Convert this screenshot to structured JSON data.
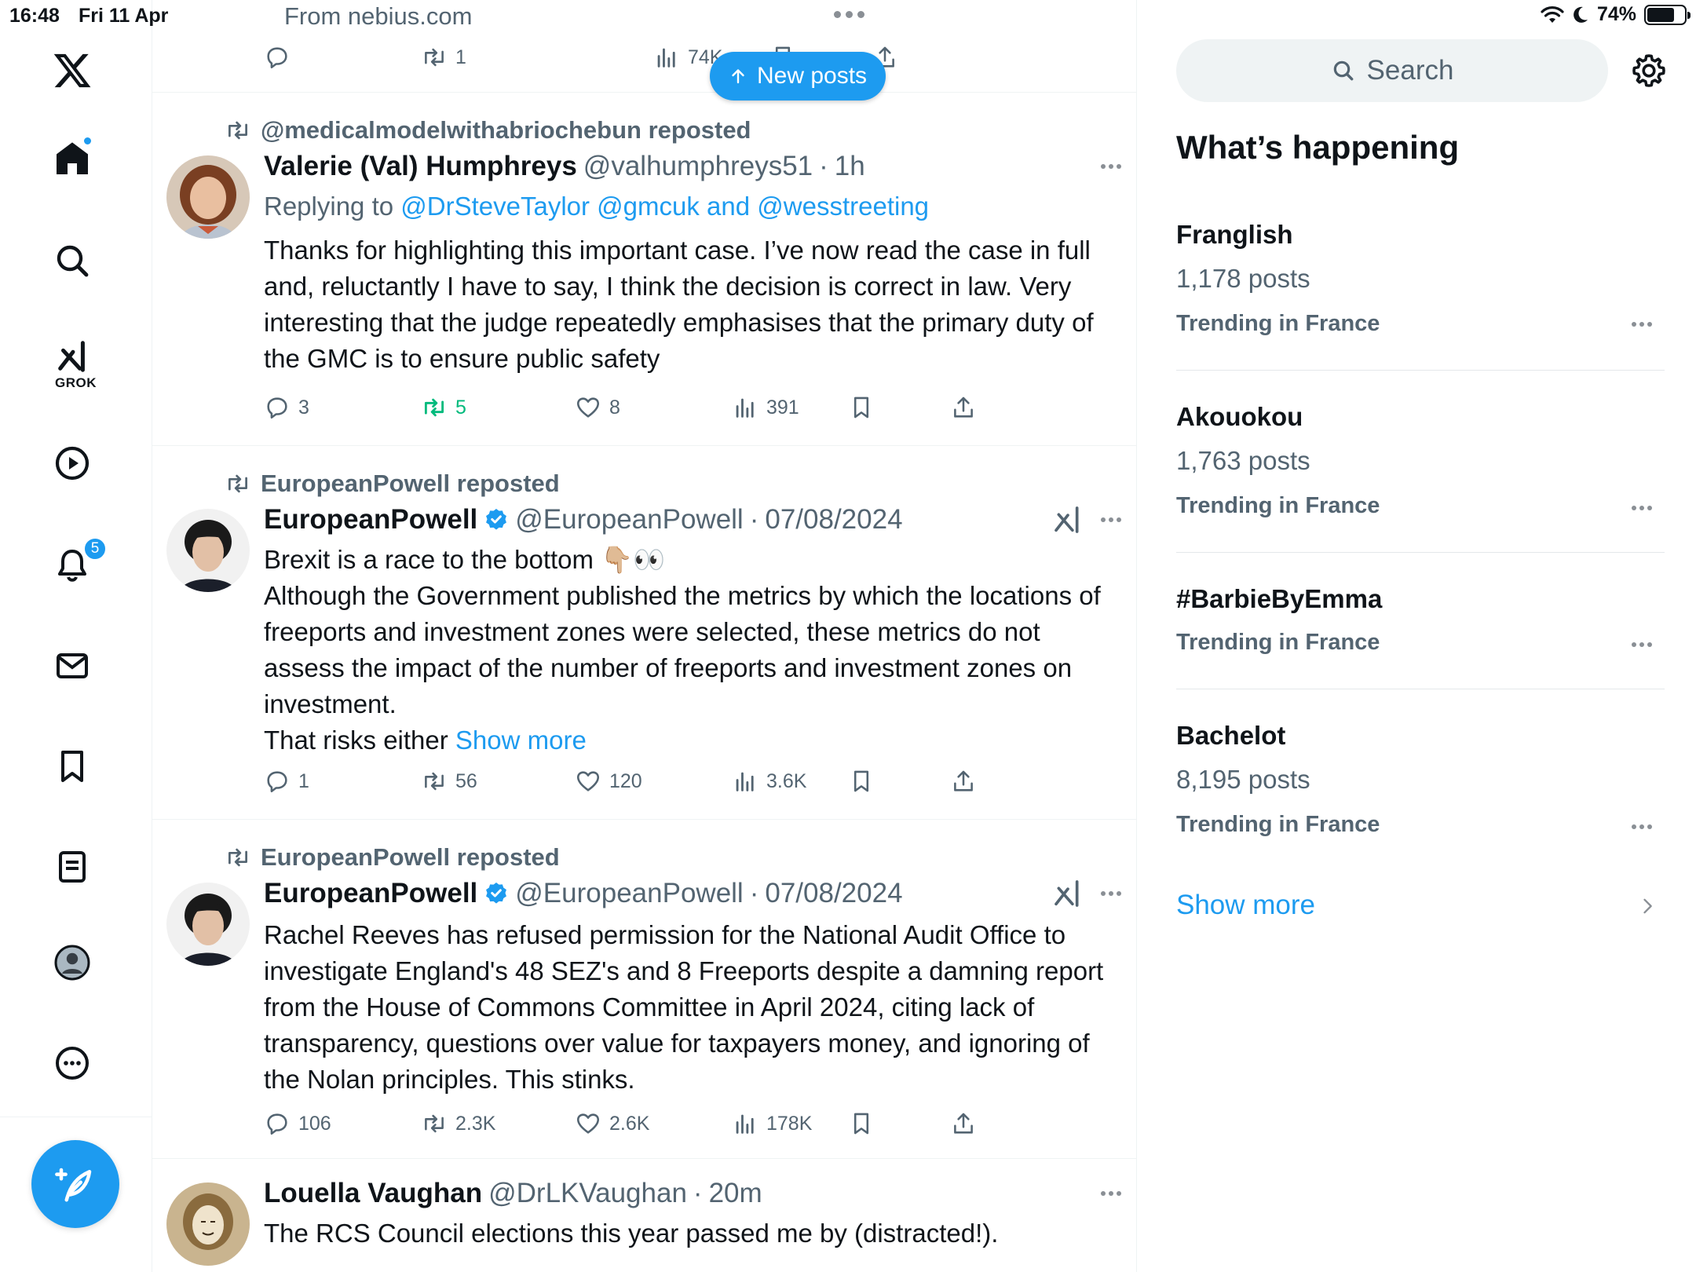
{
  "status_bar": {
    "time": "16:48",
    "date": "Fri 11 Apr",
    "source": "From nebius.com",
    "battery": "74%",
    "battery_level": 0.74
  },
  "nav": {
    "grok_label": "GROK",
    "notifications_badge": "5"
  },
  "new_posts_label": "New posts",
  "partial_post": {
    "retweets": "1",
    "views": "74K"
  },
  "posts": [
    {
      "repost_by": "@medicalmodelwithabriochebun reposted",
      "name": "Valerie (Val) Humphreys",
      "handle": "@valhumphreys51",
      "time": "1h",
      "reply_prefix": "Replying to",
      "reply_to": "@DrSteveTaylor @gmcuk and @wesstreeting",
      "text": "Thanks for highlighting this important case. I’ve now read the case in full and, reluctantly I have to say, I think the decision is correct in law. Very interesting that the judge repeatedly emphasises that the primary duty of the GMC is to ensure public safety",
      "replies": "3",
      "retweets": "5",
      "likes": "8",
      "views": "391"
    },
    {
      "repost_by": "EuropeanPowell reposted",
      "name": "EuropeanPowell",
      "handle": "@EuropeanPowell",
      "time": "07/08/2024",
      "text_line1": "Brexit is a race to the bottom 👇🏼👀",
      "text": "Although the Government published the metrics by which the locations of freeports and investment zones were selected, these metrics do not assess the impact of the number of freeports and investment zones on investment.",
      "text_tail": "That risks either",
      "show_more": "Show more",
      "replies": "1",
      "retweets": "56",
      "likes": "120",
      "views": "3.6K"
    },
    {
      "repost_by": "EuropeanPowell reposted",
      "name": "EuropeanPowell",
      "handle": "@EuropeanPowell",
      "time": "07/08/2024",
      "text": "Rachel Reeves has refused permission for the National Audit Office to investigate England's 48 SEZ's and 8 Freeports despite a damning report from the House of Commons Committee in April 2024, citing lack of transparency, questions over value for taxpayers money, and ignoring of the Nolan principles. This stinks.",
      "replies": "106",
      "retweets": "2.3K",
      "likes": "2.6K",
      "views": "178K"
    },
    {
      "name": "Louella Vaughan",
      "handle": "@DrLKVaughan",
      "time": "20m",
      "text": "The RCS Council elections this year passed me by (distracted!)."
    }
  ],
  "sidebar": {
    "search_placeholder": "Search",
    "title": "What’s happening",
    "trends": [
      {
        "name": "Franglish",
        "count": "1,178 posts",
        "location": "Trending in France"
      },
      {
        "name": "Akouokou",
        "count": "1,763 posts",
        "location": "Trending in France"
      },
      {
        "name": "#BarbieByEmma",
        "count": "",
        "location": "Trending in France"
      },
      {
        "name": "Bachelot",
        "count": "8,195 posts",
        "location": "Trending in France"
      }
    ],
    "show_more": "Show more"
  },
  "colors": {
    "accent": "#1d9bf0",
    "secondary_text": "#536471",
    "retweet_green": "#00ba7c"
  }
}
